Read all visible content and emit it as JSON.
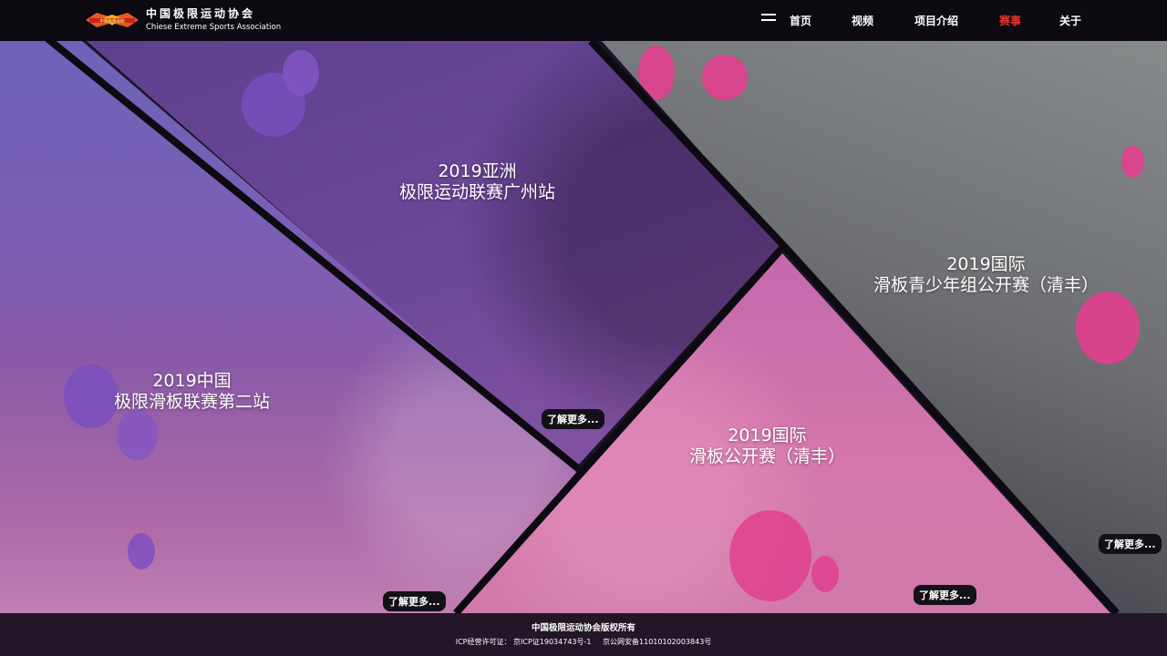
{
  "header": {
    "logo_text": "中国极限运动",
    "org_name_cn": "中国极限运动协会",
    "org_name_en": "Chiese Extreme Sports Association",
    "nav": [
      {
        "label": "首页",
        "active": false
      },
      {
        "label": "视频",
        "active": false
      },
      {
        "label": "项目介绍",
        "active": false
      },
      {
        "label": "赛事",
        "active": true
      },
      {
        "label": "关于",
        "active": false
      }
    ],
    "menu_icon": "hamburger-icon",
    "active_color": "#e4342b"
  },
  "events": [
    {
      "title_line1": "2019中国",
      "title_line2": "极限滑板联赛第二站",
      "more_label": "了解更多..."
    },
    {
      "title_line1": "2019亚洲",
      "title_line2": "极限运动联赛广州站",
      "more_label": "了解更多..."
    },
    {
      "title_line1": "2019国际",
      "title_line2": "滑板青少年组公开赛（清丰）",
      "more_label": "了解更多..."
    },
    {
      "title_line1": "2019国际",
      "title_line2": "滑板公开赛（清丰）",
      "more_label": "了解更多..."
    }
  ],
  "footer": {
    "copyright": "中国极限运动协会版权所有",
    "icp": "ICP经营许可证： 京ICP证19034743号-1",
    "police": "京公网安备11010102003843号"
  },
  "colors": {
    "purple": "#7a5fb6",
    "pink": "#d477ac",
    "splat_pink": "#e23f8f",
    "splat_purple": "#7a4fc0"
  }
}
